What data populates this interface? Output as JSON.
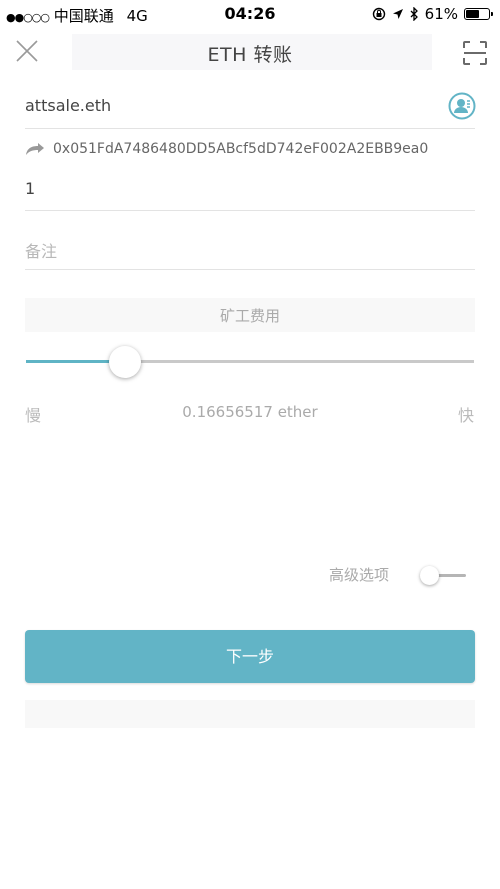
{
  "status_bar": {
    "signal": "●●○○○",
    "carrier": "中国联通",
    "network": "4G",
    "time": "04:26",
    "battery_text": "61%",
    "battery_level": 0.61
  },
  "nav": {
    "title": "ETH 转账",
    "close_icon": "close-icon",
    "scan_icon": "scan-icon"
  },
  "form": {
    "recipient": "attsale.eth",
    "resolved_address": "0x051FdA7486480DD5ABcf5dD742eF002A2EBB9ea0",
    "amount": "1",
    "note_placeholder": "备注"
  },
  "gas": {
    "label": "矿工费用",
    "slow_label": "慢",
    "fast_label": "快",
    "value": "0.16656517 ether",
    "slider_level": 0.22
  },
  "advanced": {
    "label": "高级选项",
    "enabled": false
  },
  "next_button": "下一步",
  "colors": {
    "accent": "#62b4c6",
    "track": "#c9c9c9",
    "muted_text": "#aaaaaa"
  }
}
